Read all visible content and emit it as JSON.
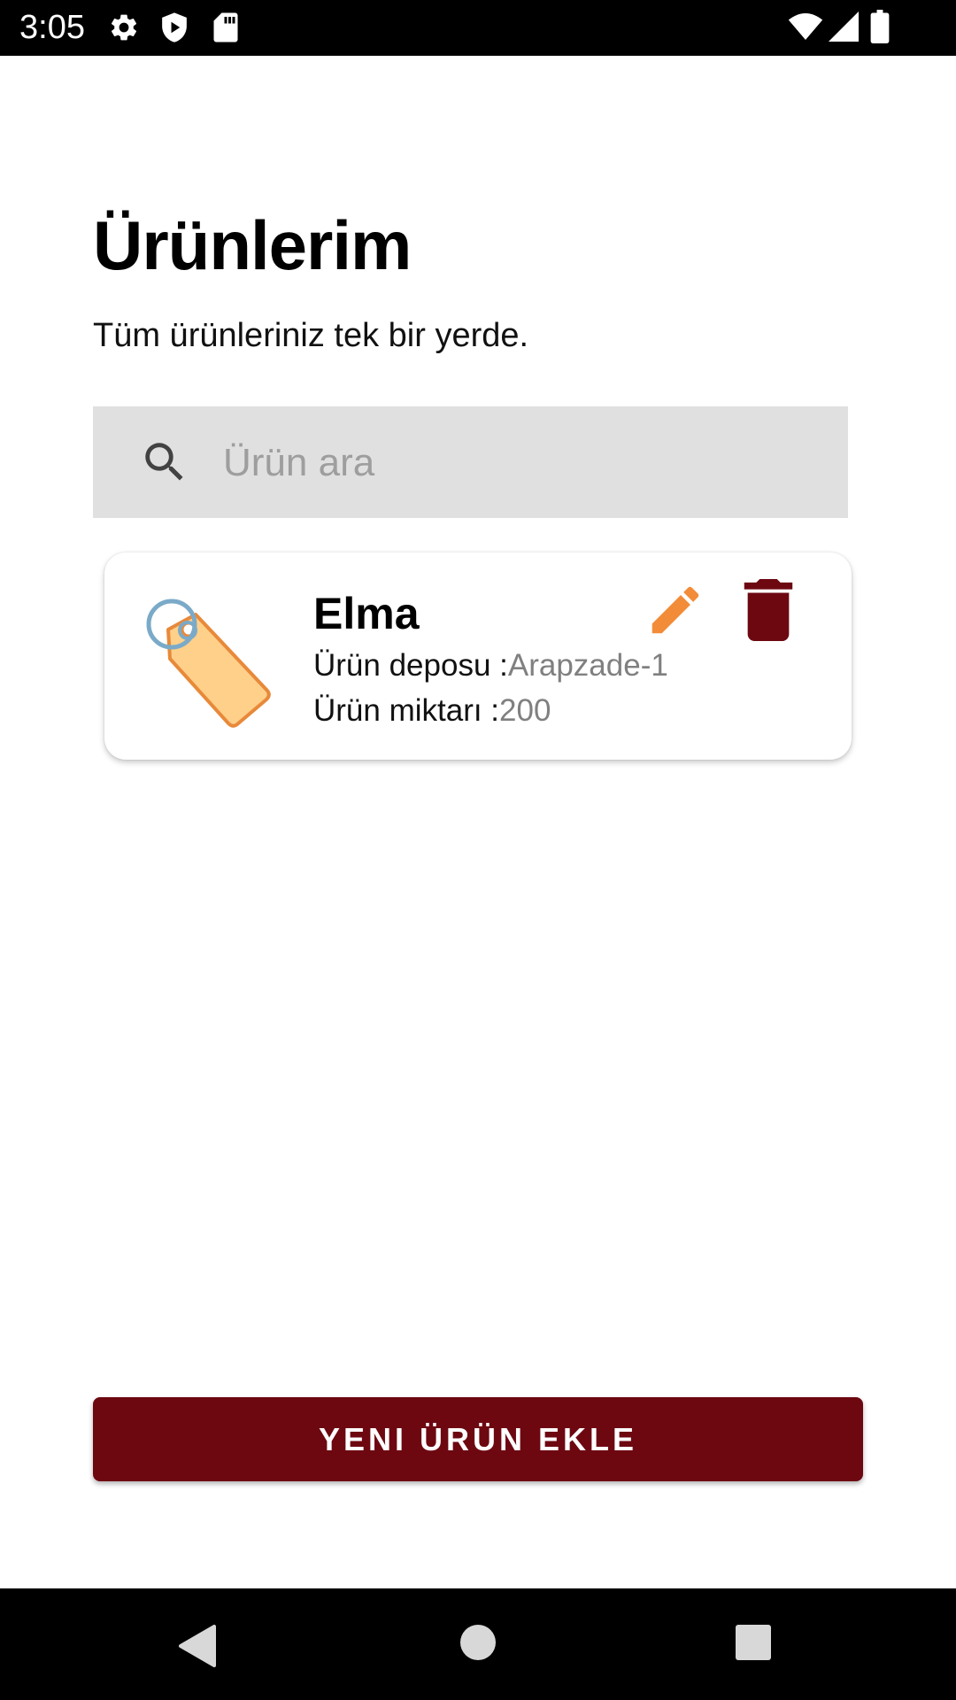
{
  "status_bar": {
    "time": "3:05",
    "left_icons": [
      "settings-icon",
      "play-protect-icon",
      "sd-card-icon"
    ],
    "right_icons": [
      "wifi-icon",
      "signal-icon",
      "battery-icon"
    ]
  },
  "page": {
    "title": "Ürünlerim",
    "subtitle": "Tüm ürünleriniz tek bir yerde."
  },
  "search": {
    "placeholder": "Ürün ara",
    "value": "",
    "icon": "search-icon"
  },
  "products": [
    {
      "name": "Elma",
      "depot_label": "Ürün deposu :",
      "depot_value": "Arapzade-1",
      "quantity_label": "Ürün miktarı :",
      "quantity_value": "200",
      "image_icon": "price-tag-icon",
      "edit_icon": "pencil-icon",
      "delete_icon": "trash-icon"
    }
  ],
  "actions": {
    "add_product_label": "YENI ÜRÜN EKLE"
  },
  "navigation": {
    "icons": [
      "back-icon",
      "home-icon",
      "recents-icon"
    ]
  },
  "colors": {
    "primary": "#6d0811",
    "edit_accent": "#f28c38",
    "delete_accent": "#6d0811",
    "search_background": "#e0e0e0",
    "secondary_text": "#808080",
    "tag_fill": "#ffd08a",
    "tag_ring": "#7aaac8"
  }
}
